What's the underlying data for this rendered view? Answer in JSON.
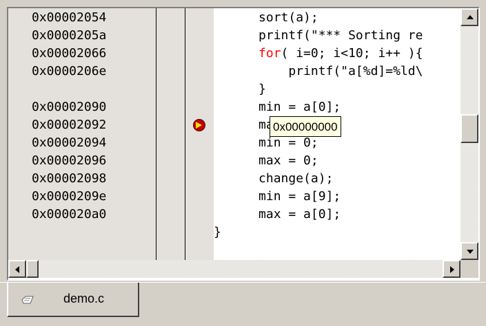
{
  "editor": {
    "addresses": [
      "0x00002054",
      "0x0000205a",
      "0x00002066",
      "0x0000206e",
      "",
      "0x00002090",
      "0x00002092",
      "0x00002094",
      "0x00002096",
      "0x00002098",
      "0x0000209e",
      "0x000020a0",
      ""
    ],
    "source_lines": [
      {
        "indent": "      ",
        "keyword": "",
        "text": "sort(a);"
      },
      {
        "indent": "      ",
        "keyword": "",
        "text": "printf(\"*** Sorting re"
      },
      {
        "indent": "      ",
        "keyword": "for",
        "text": "( i=0; i<10; i++ ){"
      },
      {
        "indent": "          ",
        "keyword": "",
        "text": "printf(\"a[%d]=%ld\\"
      },
      {
        "indent": "      ",
        "keyword": "",
        "text": "}"
      },
      {
        "indent": "      ",
        "keyword": "",
        "text": "min = a[0];"
      },
      {
        "indent": "      ",
        "keyword": "",
        "text": "max = a[9];"
      },
      {
        "indent": "      ",
        "keyword": "",
        "text": "min = 0;"
      },
      {
        "indent": "      ",
        "keyword": "",
        "text": "max = 0;"
      },
      {
        "indent": "      ",
        "keyword": "",
        "text": "change(a);"
      },
      {
        "indent": "      ",
        "keyword": "",
        "text": "min = a[9];"
      },
      {
        "indent": "      ",
        "keyword": "",
        "text": "max = a[0];"
      },
      {
        "indent": "",
        "keyword": "",
        "text": "}"
      }
    ],
    "current_line_index": 6,
    "keyword_color": "#ff0000"
  },
  "tooltip": {
    "text": "0x00000000"
  },
  "tabs": [
    {
      "label": "demo.c",
      "icon": "c-source-file-icon"
    }
  ]
}
